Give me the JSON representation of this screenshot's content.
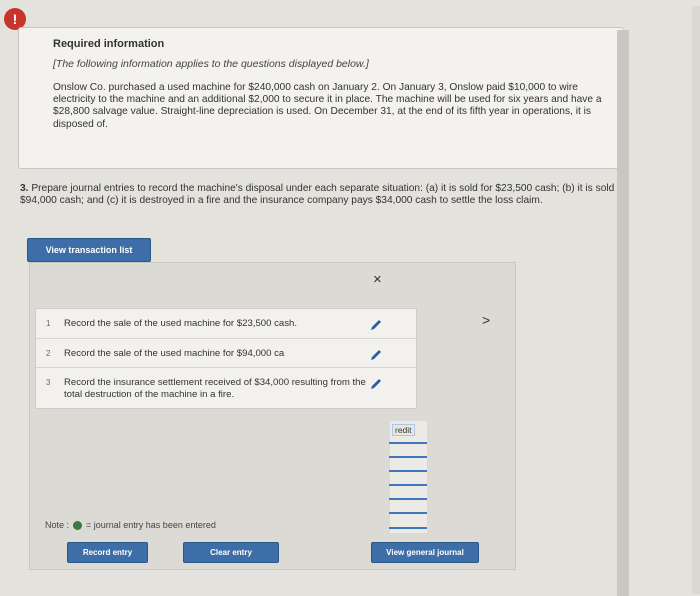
{
  "alert": {
    "icon": "exclamation-icon",
    "text": "!"
  },
  "required_info": {
    "title": "Required information",
    "subtitle": "[The following information applies to the questions displayed below.]",
    "body": "Onslow Co. purchased a used machine for $240,000 cash on January 2. On January 3, Onslow paid $10,000 to wire electricity to the machine and an additional $2,000 to secure it in place. The machine will be used for six years and have a $28,800 salvage value. Straight-line depreciation is used. On December 31, at the end of its fifth year in operations, it is disposed of."
  },
  "question": {
    "number": "3.",
    "text": "Prepare journal entries to record the machine's disposal under each separate situation: (a) it is sold for $23,500 cash; (b) it is sold for $94,000 cash; and (c) it is destroyed in a fire and the insurance company pays $34,000 cash to settle the loss claim."
  },
  "view_transaction_list_label": "View transaction list",
  "close_label": "×",
  "transactions": [
    {
      "num": "1",
      "text": "Record the sale of the used machine for $23,500 cash."
    },
    {
      "num": "2",
      "text": "Record the sale of the used machine for $94,000 ca"
    },
    {
      "num": "3",
      "text": "Record the insurance settlement received of $34,000 resulting from the total destruction of the machine in a fire."
    }
  ],
  "credit_label": "redit",
  "next_label": ">",
  "note": {
    "prefix": "Note :",
    "suffix": "= journal entry has been entered",
    "dot_color": "#3a7a3a"
  },
  "buttons": {
    "record_entry": "Record entry",
    "clear_entry": "Clear entry",
    "view_general_journal": "View general journal"
  },
  "colors": {
    "accent": "#3e6ea8",
    "alert": "#c8332b",
    "edit_icon": "#2d5f9e"
  }
}
